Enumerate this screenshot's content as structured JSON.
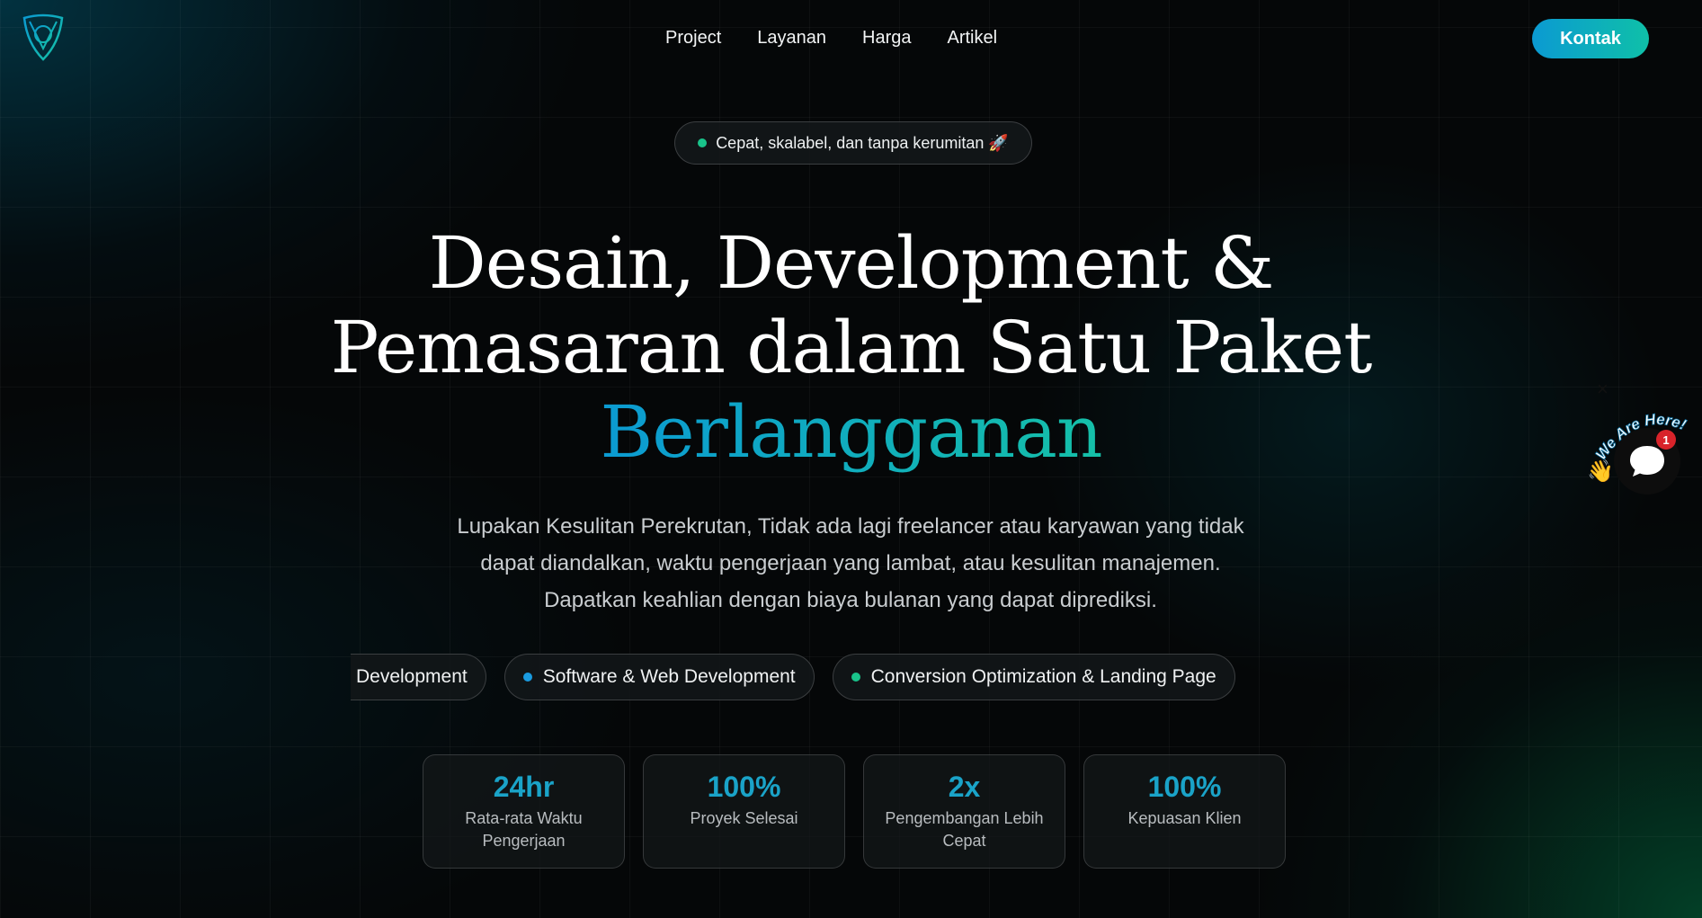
{
  "brand": {
    "logo_icon": "triangle-knot-logo-icon",
    "accent_color": "#0b9ad2",
    "accent_color_2": "#0fc0a8"
  },
  "nav": {
    "links": [
      "Project",
      "Layanan",
      "Harga",
      "Artikel"
    ],
    "contact_label": "Kontak"
  },
  "badge": {
    "text": "Cepat, skalabel, dan tanpa kerumitan 🚀",
    "dot_color": "#19c38a"
  },
  "hero": {
    "line1": "Desain, Development &",
    "line2": "Pemasaran dalam Satu Paket",
    "line3_accent": "Berlangganan",
    "subtitle_line1": "Lupakan Kesulitan Perekrutan, Tidak ada lagi freelancer atau karyawan yang tidak",
    "subtitle_line2": "dapat diandalkan, waktu pengerjaan yang lambat, atau kesulitan manajemen.",
    "subtitle_line3": "Dapatkan keahlian dengan biaya bulanan yang dapat diprediksi."
  },
  "services": [
    {
      "label": "Brand Storytelling & Campaign Development",
      "dot_color": "#19c38a"
    },
    {
      "label": "Software & Web Development",
      "dot_color": "#1a9be0"
    },
    {
      "label": "Conversion Optimization & Landing Page",
      "dot_color": "#19c38a"
    }
  ],
  "stats": [
    {
      "value": "24hr",
      "label": "Rata-rata Waktu Pengerjaan"
    },
    {
      "value": "100%",
      "label": "Proyek Selesai"
    },
    {
      "value": "2x",
      "label": "Pengembangan Lebih Cepat"
    },
    {
      "value": "100%",
      "label": "Kepuasan Klien"
    }
  ],
  "chat": {
    "close_label": "×",
    "headline": "We Are Here!",
    "badge_count": "1",
    "wave_icon": "waving-hand-icon",
    "bubble_icon": "chat-bubble-icon"
  }
}
